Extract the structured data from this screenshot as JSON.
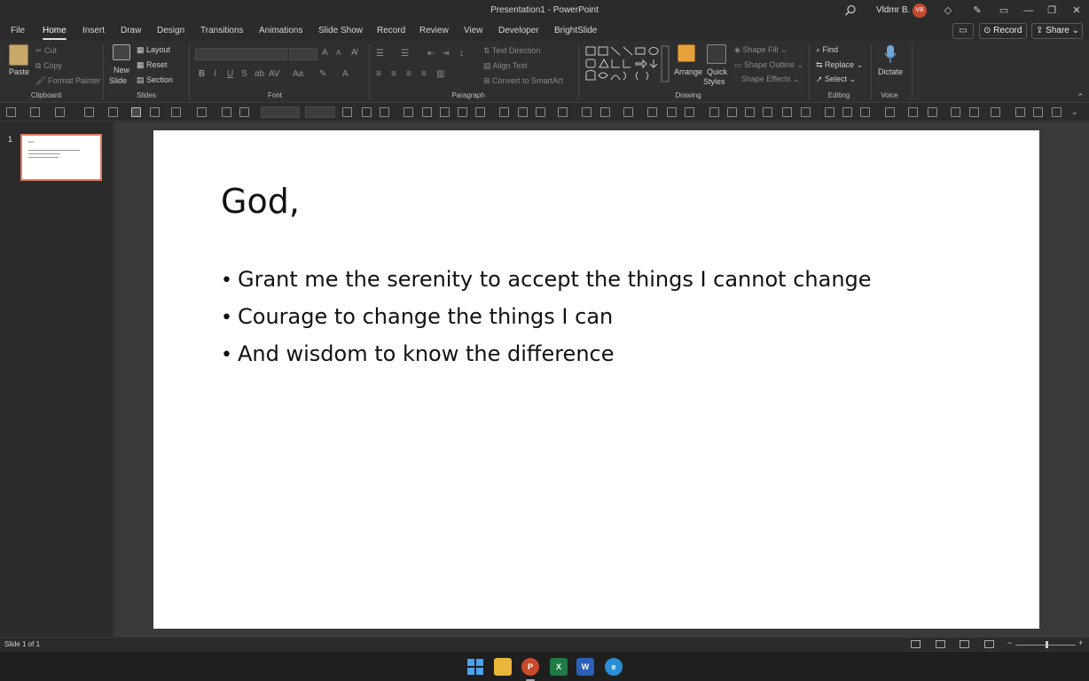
{
  "titlebar": {
    "title": "Presentation1  -  PowerPoint",
    "user_name": "Vldmr B.",
    "avatar_initials": "VB"
  },
  "tabs": [
    "File",
    "Home",
    "Insert",
    "Draw",
    "Design",
    "Transitions",
    "Animations",
    "Slide Show",
    "Record",
    "Review",
    "View",
    "Developer",
    "BrightSlide"
  ],
  "tab_buttons": {
    "record": "Record",
    "share": "Share"
  },
  "ribbon": {
    "clipboard": {
      "paste": "Paste",
      "cut": "Cut",
      "copy": "Copy",
      "format_painter": "Format Painter",
      "label": "Clipboard"
    },
    "slides": {
      "new_slide": "New",
      "new_slide2": "Slide",
      "layout": "Layout",
      "reset": "Reset",
      "section": "Section",
      "label": "Slides"
    },
    "font": {
      "label": "Font"
    },
    "paragraph": {
      "text_direction": "Text Direction",
      "align_text": "Align Text",
      "convert_smartart": "Convert to SmartArt",
      "label": "Paragraph"
    },
    "drawing": {
      "arrange": "Arrange",
      "quick_styles": "Quick",
      "quick_styles2": "Styles",
      "shape_fill": "Shape Fill",
      "shape_outline": "Shape Outline",
      "shape_effects": "Shape Effects",
      "label": "Drawing"
    },
    "editing": {
      "find": "Find",
      "replace": "Replace",
      "select": "Select",
      "label": "Editing"
    },
    "voice": {
      "dictate": "Dictate",
      "label": "Voice"
    }
  },
  "thumbnail": {
    "number": "1"
  },
  "slide": {
    "title": "God,",
    "bullets": [
      "Grant me the serenity to accept the things I cannot change",
      "Courage to change the things I can",
      "And wisdom to know the difference"
    ]
  },
  "status": {
    "slide_info": "Slide 1 of 1"
  },
  "taskbar": {
    "apps": [
      "start",
      "file-explorer",
      "powerpoint",
      "excel",
      "word",
      "edge"
    ]
  }
}
